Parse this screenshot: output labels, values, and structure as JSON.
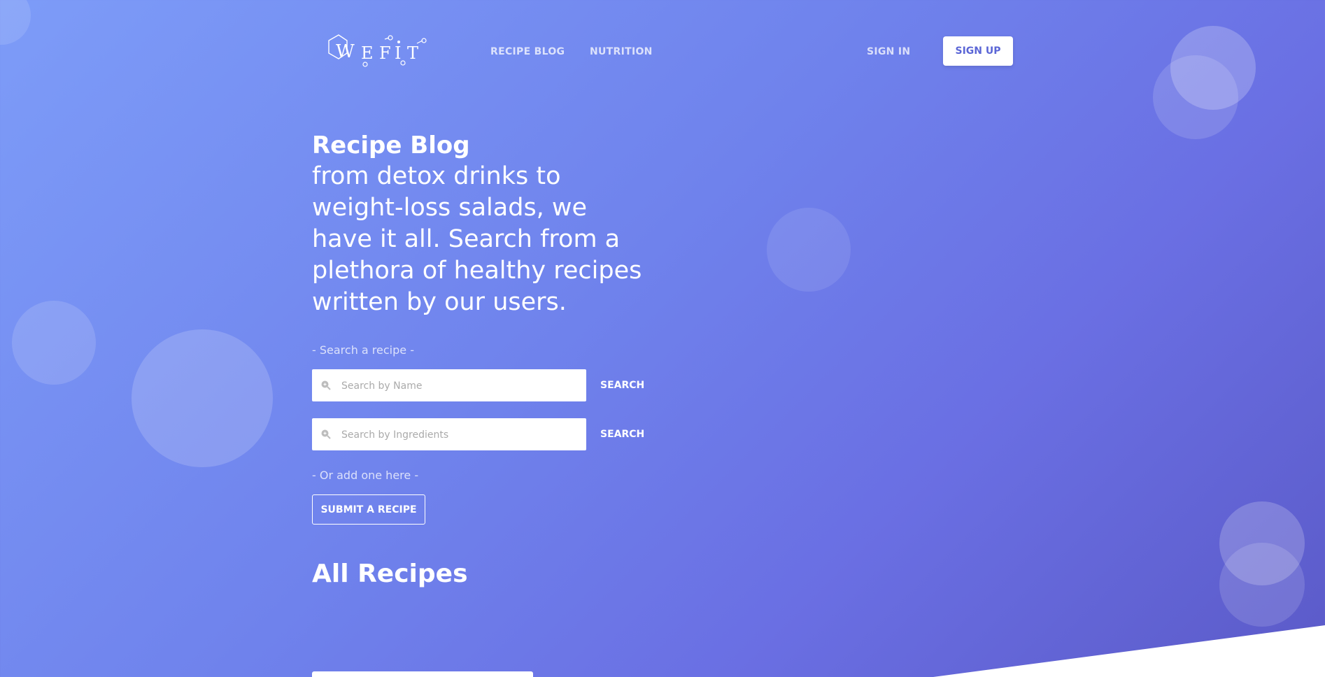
{
  "brand": {
    "logo_text": "WEFIT"
  },
  "nav": {
    "recipe_blog": "RECIPE BLOG",
    "nutrition": "NUTRITION",
    "sign_in": "SIGN IN",
    "sign_up": "SIGN UP"
  },
  "hero": {
    "title": "Recipe Blog",
    "subtitle": "from detox drinks to weight-loss salads, we have it all. Search from a plethora of healthy recipes written by our users."
  },
  "search": {
    "hint": "- Search a recipe -",
    "name_placeholder": "Search by Name",
    "ingredients_placeholder": "Search by Ingredients",
    "button_label": "SEARCH"
  },
  "submit": {
    "hint": "- Or add one here -",
    "button_label": "SUBMIT A RECIPE"
  },
  "recipes": {
    "heading": "All Recipes"
  },
  "icons": {
    "search": "search-icon"
  },
  "colors": {
    "accent": "#5b66d6",
    "gradient_start": "#7d9cf8",
    "gradient_end": "#5b5ac8"
  }
}
